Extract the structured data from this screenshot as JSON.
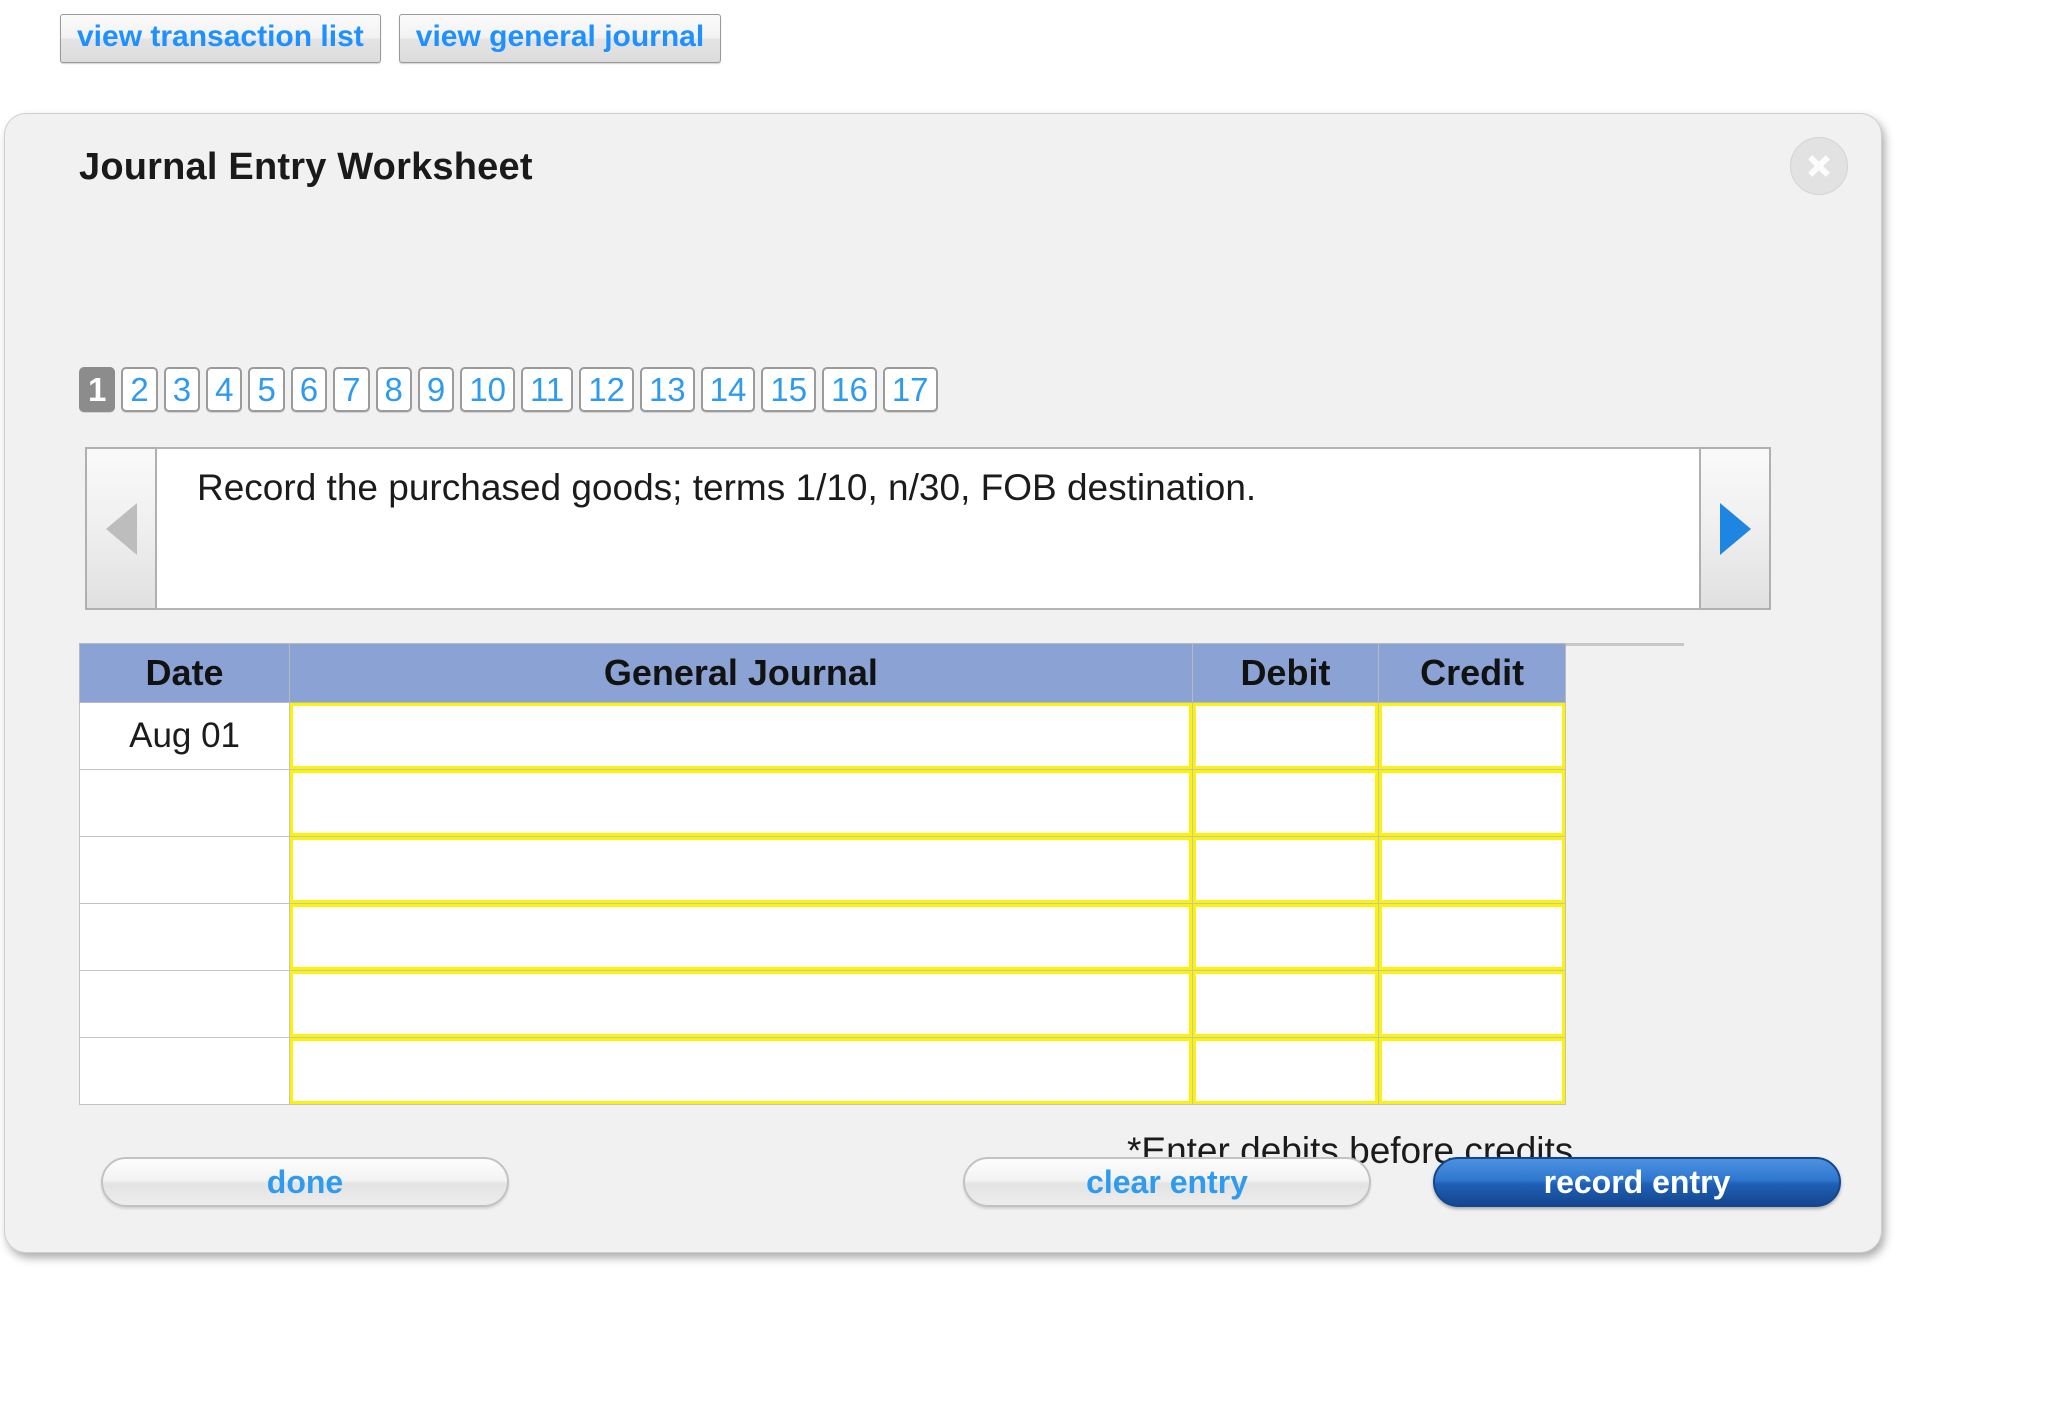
{
  "toolbar": {
    "view_transaction_list": "view transaction list",
    "view_general_journal": "view general journal"
  },
  "panel": {
    "title": "Journal Entry Worksheet",
    "close_icon": "close-icon"
  },
  "tabs": {
    "active": "1",
    "items": [
      "1",
      "2",
      "3",
      "4",
      "5",
      "6",
      "7",
      "8",
      "9",
      "10",
      "11",
      "12",
      "13",
      "14",
      "15",
      "16",
      "17"
    ]
  },
  "prompt": {
    "prev_icon": "triangle-left-icon",
    "next_icon": "triangle-right-icon",
    "text": "Record the purchased goods; terms 1/10, n/30, FOB destination."
  },
  "table": {
    "headers": {
      "date": "Date",
      "general_journal": "General Journal",
      "debit": "Debit",
      "credit": "Credit"
    },
    "rows": [
      {
        "date": "Aug 01",
        "general_journal": "",
        "debit": "",
        "credit": ""
      },
      {
        "date": "",
        "general_journal": "",
        "debit": "",
        "credit": ""
      },
      {
        "date": "",
        "general_journal": "",
        "debit": "",
        "credit": ""
      },
      {
        "date": "",
        "general_journal": "",
        "debit": "",
        "credit": ""
      },
      {
        "date": "",
        "general_journal": "",
        "debit": "",
        "credit": ""
      },
      {
        "date": "",
        "general_journal": "",
        "debit": "",
        "credit": ""
      }
    ]
  },
  "note": "*Enter debits before credits",
  "actions": {
    "done": "done",
    "clear_entry": "clear entry",
    "record_entry": "record entry"
  },
  "colors": {
    "link_blue": "#2e9bef",
    "header_blue": "#8ba3d4",
    "input_yellow": "#fbf40a",
    "primary_blue": "#1f5fb5",
    "panel_gray": "#f1f1f1"
  }
}
